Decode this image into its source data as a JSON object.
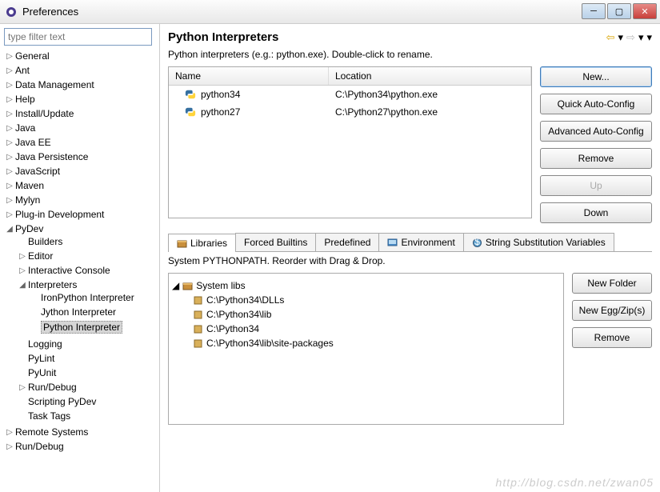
{
  "window": {
    "title": "Preferences"
  },
  "filter": {
    "placeholder": "type filter text"
  },
  "tree": {
    "items": [
      "General",
      "Ant",
      "Data Management",
      "Help",
      "Install/Update",
      "Java",
      "Java EE",
      "Java Persistence",
      "JavaScript",
      "Maven",
      "Mylyn",
      "Plug-in Development"
    ],
    "pydev": {
      "label": "PyDev",
      "children": [
        "Builders",
        "Editor",
        "Interactive Console"
      ],
      "interpreters": {
        "label": "Interpreters",
        "children": [
          "IronPython Interpreter",
          "Jython Interpreter",
          "Python Interpreter"
        ]
      },
      "after": [
        "Logging",
        "PyLint",
        "PyUnit",
        "Run/Debug",
        "Scripting PyDev",
        "Task Tags"
      ]
    },
    "tail": [
      "Remote Systems",
      "Run/Debug"
    ]
  },
  "page": {
    "title": "Python Interpreters",
    "desc": "Python interpreters (e.g.: python.exe).   Double-click to rename."
  },
  "table": {
    "cols": [
      "Name",
      "Location"
    ],
    "rows": [
      {
        "name": "python34",
        "loc": "C:\\Python34\\python.exe"
      },
      {
        "name": "python27",
        "loc": "C:\\Python27\\python.exe"
      }
    ]
  },
  "sidebtns": {
    "new": "New...",
    "qac": "Quick Auto-Config",
    "aac": "Advanced Auto-Config",
    "remove": "Remove",
    "up": "Up",
    "down": "Down"
  },
  "tabs": [
    "Libraries",
    "Forced Builtins",
    "Predefined",
    "Environment",
    "String Substitution Variables"
  ],
  "pypath": {
    "desc": "System PYTHONPATH.   Reorder with Drag & Drop."
  },
  "libs": {
    "root": "System libs",
    "items": [
      "C:\\Python34\\DLLs",
      "C:\\Python34\\lib",
      "C:\\Python34",
      "C:\\Python34\\lib\\site-packages"
    ]
  },
  "libbtns": {
    "newfolder": "New Folder",
    "newegg": "New Egg/Zip(s)",
    "remove": "Remove"
  },
  "watermark": "http://blog.csdn.net/zwan05"
}
